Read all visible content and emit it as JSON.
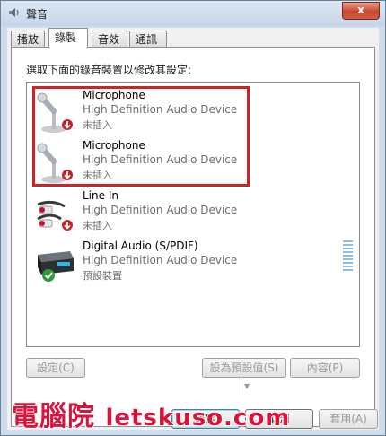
{
  "window": {
    "title": "聲音",
    "close_label": "x"
  },
  "tabs": [
    {
      "label": "播放"
    },
    {
      "label": "錄製",
      "active": true
    },
    {
      "label": "音效"
    },
    {
      "label": "通訊"
    }
  ],
  "instruction": "選取下面的錄音裝置以修改其設定:",
  "devices": [
    {
      "name": "Microphone",
      "description": "High Definition Audio Device",
      "status": "未插入",
      "icon": "microphone-icon"
    },
    {
      "name": "Microphone",
      "description": "High Definition Audio Device",
      "status": "未插入",
      "icon": "microphone-icon"
    },
    {
      "name": "Line In",
      "description": "High Definition Audio Device",
      "status": "未插入",
      "icon": "line-in-cable-icon"
    },
    {
      "name": "Digital Audio (S/PDIF)",
      "description": "High Definition Audio Device",
      "status": "預設裝置",
      "icon": "digital-audio-device-icon"
    }
  ],
  "buttons": {
    "configure": "設定(C)",
    "set_default": "設為預設值(S)",
    "properties": "內容(P)",
    "ok": "確定",
    "cancel": "取消",
    "apply": "套用(A)"
  },
  "watermark": {
    "text_cn": "電腦院",
    "text_en": "letskuso.com"
  },
  "colors": {
    "highlight": "#d42025",
    "watermark": "#d7143c"
  }
}
